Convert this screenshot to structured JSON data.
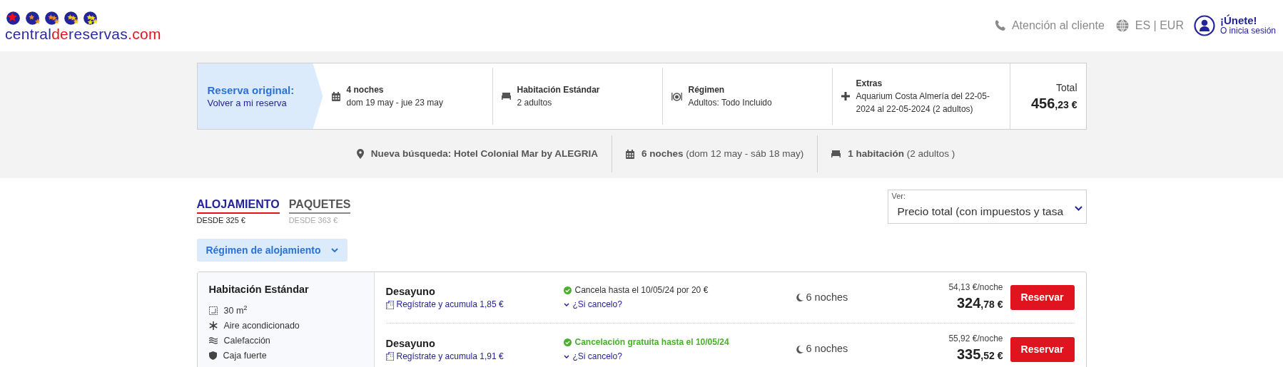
{
  "header": {
    "logo": {
      "parts": [
        {
          "text": "central",
          "color": "#2b2b9b"
        },
        {
          "text": "de",
          "color": "#e0141e"
        },
        {
          "text": "reservas",
          "color": "#2b2b9b"
        },
        {
          "text": ".com",
          "color": "#e0141e"
        }
      ]
    },
    "support": "Atención al cliente",
    "locale": "ES | EUR",
    "join": "¡Únete!",
    "login": "O inicia sesión"
  },
  "original_booking": {
    "title": "Reserva original:",
    "link": "Volver a mi reserva",
    "sections": [
      {
        "kind": "dates",
        "title": "4 noches",
        "detail": "dom 19 may - jue 23 may"
      },
      {
        "kind": "room",
        "title": "Habitación Estándar",
        "detail": "2 adultos"
      },
      {
        "kind": "board",
        "title": "Régimen",
        "detail": "Adultos: Todo Incluido"
      },
      {
        "kind": "extras",
        "title": "Extras",
        "detail": "Aquarium Costa Almería del 22-05-2024 al 22-05-2024 (2 adultos)"
      }
    ],
    "total_label": "Total",
    "total_main": "456",
    "total_fraction": ",23 €"
  },
  "new_search": [
    {
      "kind": "place",
      "text": "Nueva búsqueda: Hotel Colonial Mar by ALEGRIA"
    },
    {
      "kind": "dates",
      "text": "**6 noches** (dom 12 may - sáb 18 may)"
    },
    {
      "kind": "rooms",
      "text": "**1 habitación** (2 adultos )"
    }
  ],
  "tabs": [
    {
      "label": "ALOJAMIENTO",
      "sub": "DESDE 325 €",
      "selected": true
    },
    {
      "label": "PAQUETES",
      "sub": "DESDE 363 €",
      "selected": false
    }
  ],
  "view": {
    "label": "Ver:",
    "value": "Precio total (con impuestos y tasa"
  },
  "board_filter": "Régimen de alojamiento",
  "room": {
    "name": "Habitación Estándar",
    "amenities": [
      {
        "kind": "size",
        "text": "30 m$^{2}$"
      },
      {
        "kind": "ac",
        "text": "Aire acondicionado"
      },
      {
        "kind": "heating",
        "text": "Calefacción"
      },
      {
        "kind": "safe",
        "text": "Caja fuerte"
      }
    ],
    "rates": [
      {
        "board": "Desayuno",
        "loyalty": "Regístrate y acumula 1,85 €",
        "cancel": "Cancela hasta el 10/05/24 por 20 €",
        "free_cancel": false,
        "cancel_info": "¿Si cancelo?",
        "nights": "6 noches",
        "per_night": "54,13 €/noche",
        "price_main": "324",
        "price_fraction": ",78 €",
        "button": "Reservar"
      },
      {
        "board": "Desayuno",
        "loyalty": "Regístrate y acumula 1,91 €",
        "cancel": "Cancelación gratuita hasta el 10/05/24",
        "free_cancel": true,
        "cancel_info": "¿Si cancelo?",
        "nights": "6 noches",
        "per_night": "55,92 €/noche",
        "price_main": "335",
        "price_fraction": ",52 €",
        "button": "Reservar"
      }
    ]
  }
}
